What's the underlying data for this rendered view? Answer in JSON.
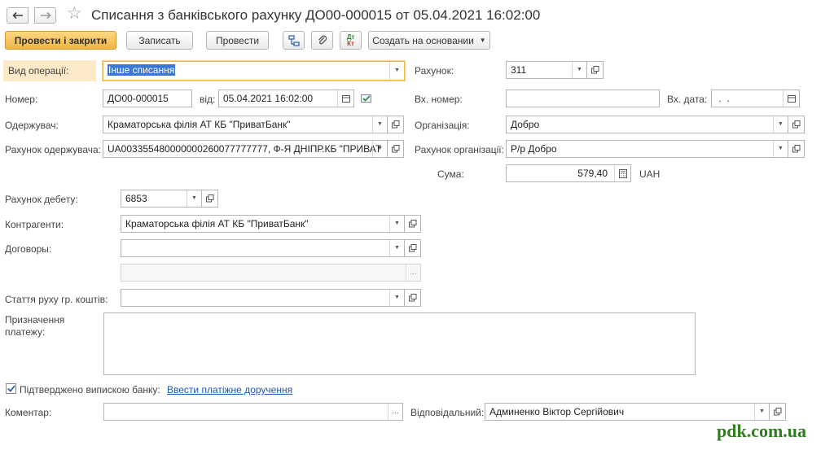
{
  "window": {
    "title": "Списання з банківського рахунку ДО00-000015 от 05.04.2021 16:02:00",
    "nav": [
      "arrow-left-icon",
      "arrow-right-icon"
    ],
    "favorite_icon": "star-icon"
  },
  "toolbar": {
    "post_close": "Провести і закрити",
    "save": "Записать",
    "post": "Провести",
    "create_based_on": "Создать на основании",
    "icons": [
      "structure-icon",
      "paperclip-icon",
      "dt-kt-icon"
    ],
    "dt_kt": {
      "dt": "Дт",
      "kt": "Кт"
    }
  },
  "form": {
    "operation_type": {
      "label": "Вид операції:",
      "value": "Інше списання"
    },
    "number": {
      "label": "Номер:",
      "value": "ДО00-000015"
    },
    "date": {
      "label": "від:",
      "value": "05.04.2021 16:02:00"
    },
    "recipient": {
      "label": "Одержувач:",
      "value": "Краматорська філія АТ КБ \"ПриватБанк\""
    },
    "recipient_account": {
      "label": "Рахунок одержувача:",
      "value": "UA003355480000000260077777777, Ф-Я ДНІПР.КБ \"ПРИВАТ"
    },
    "account": {
      "label": "Рахунок:",
      "value": "311"
    },
    "incoming_number": {
      "label": "Вх. номер:",
      "value": ""
    },
    "incoming_date": {
      "label": "Вх. дата:",
      "value": " .  .    "
    },
    "organization": {
      "label": "Організація:",
      "value": "Добро"
    },
    "org_account": {
      "label": "Рахунок організації:",
      "value": "Р/р Добро"
    },
    "sum": {
      "label": "Сума:",
      "value": "579,40",
      "currency": "UAH"
    },
    "debit_account": {
      "label": "Рахунок дебету:",
      "value": "6853"
    },
    "counterparties": {
      "label": "Контрагенти:",
      "value": "Краматорська філія АТ КБ \"ПриватБанк\""
    },
    "contracts": {
      "label": "Договоры:",
      "value": "",
      "extra_value": ""
    },
    "cash_flow_item": {
      "label": "Стаття руху гр. коштів:",
      "value": ""
    },
    "payment_purpose": {
      "label_line1": "Призначення",
      "label_line2": "платежу:",
      "value": ""
    },
    "bank_confirmed": {
      "label": "Підтверджено випискою банку:",
      "checked": true
    },
    "enter_payment_order": "Ввести платіжне доручення",
    "comment": {
      "label": "Коментар:",
      "value": ""
    },
    "responsible": {
      "label": "Відповідальний:",
      "value": "Админенко Віктор Сергійович"
    }
  },
  "watermark": "pdk.com.ua",
  "colors": {
    "primary_button": "#f0b545",
    "link": "#1f57b7",
    "watermark": "#2e7d1e",
    "selection": "#3a78d6"
  }
}
